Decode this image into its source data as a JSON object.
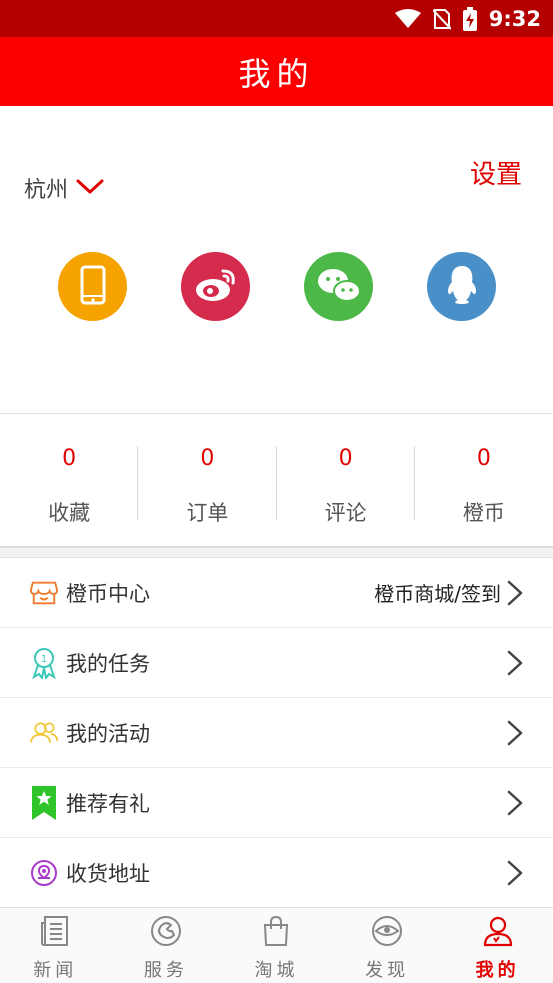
{
  "status_bar": {
    "time": "9:32"
  },
  "header": {
    "title": "我的"
  },
  "profile": {
    "city": "杭州",
    "settings_label": "设置",
    "social": [
      {
        "icon": "phone-icon",
        "color": "#f6a300"
      },
      {
        "icon": "weibo-icon",
        "color": "#d52b4c"
      },
      {
        "icon": "wechat-icon",
        "color": "#4cb847"
      },
      {
        "icon": "qq-icon",
        "color": "#4a90c8"
      }
    ]
  },
  "stats": [
    {
      "value": "0",
      "label": "收藏"
    },
    {
      "value": "0",
      "label": "订单"
    },
    {
      "value": "0",
      "label": "评论"
    },
    {
      "value": "0",
      "label": "橙币"
    }
  ],
  "menu": [
    {
      "label": "橙币中心",
      "extra": "橙币商城/签到",
      "icon": "shop-icon",
      "color": "#f07a2a"
    },
    {
      "label": "我的任务",
      "extra": "",
      "icon": "medal-icon",
      "color": "#3ec9b6"
    },
    {
      "label": "我的活动",
      "extra": "",
      "icon": "people-icon",
      "color": "#f0c835"
    },
    {
      "label": "推荐有礼",
      "extra": "",
      "icon": "bookmark-star-icon",
      "color": "#2fc42a"
    },
    {
      "label": "收货地址",
      "extra": "",
      "icon": "location-icon",
      "color": "#a83cc9"
    }
  ],
  "tabbar": [
    {
      "label": "新闻",
      "icon": "news-icon",
      "active": false
    },
    {
      "label": "服务",
      "icon": "service-icon",
      "active": false
    },
    {
      "label": "淘城",
      "icon": "shopping-bag-icon",
      "active": false
    },
    {
      "label": "发现",
      "icon": "eye-icon",
      "active": false
    },
    {
      "label": "我的",
      "icon": "user-icon",
      "active": true
    }
  ],
  "colors": {
    "header_bg": "#fb0000",
    "status_bg": "#b50000",
    "accent": "#e00000"
  }
}
